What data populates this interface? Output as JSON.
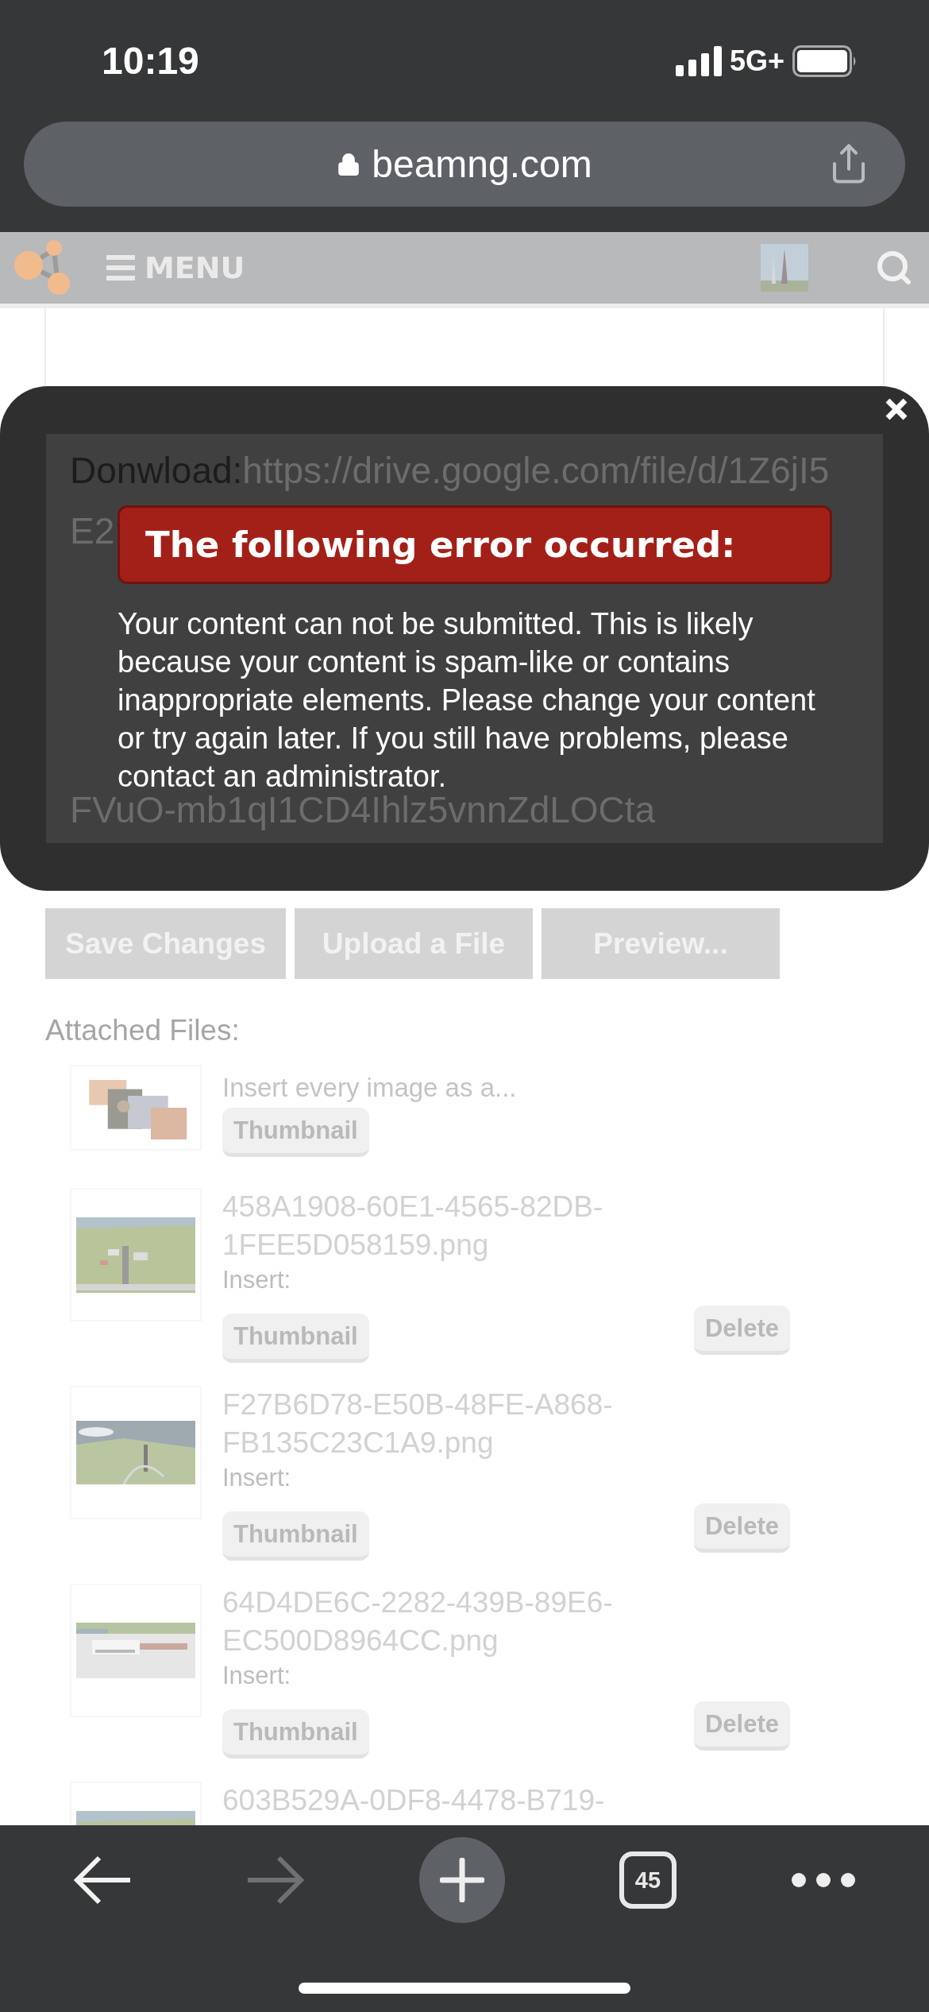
{
  "status_bar": {
    "time": "10:19",
    "network": "5G+"
  },
  "address_bar": {
    "url": "beamng.com"
  },
  "site_nav": {
    "menu_label": "MENU"
  },
  "editor": {
    "paragraphs": [
      {
        "lines": [
          [
            {
              "kind": "text",
              "text": "Donwload:"
            },
            {
              "kind": "link",
              "text": "https://drive.google.com/file/d/1Z6jI5"
            }
          ],
          [
            {
              "kind": "link",
              "text": "E2"
            }
          ]
        ]
      },
      {
        "lines": [
          [
            {
              "kind": "link",
              "text": "FVuO-mb1qI1CD4Ihlz5vnnZdLOCta"
            }
          ]
        ]
      }
    ]
  },
  "error_dialog": {
    "title": "The following error occurred:",
    "message": "Your content can not be submitted. This is likely because your content is spam-like or contains inappropriate elements. Please change your content or try again later. If you still have problems, please contact an administrator."
  },
  "actions": [
    "Save Changes",
    "Upload a File",
    "Preview..."
  ],
  "attachments": {
    "heading": "Attached Files:",
    "insert_all": {
      "label": "Insert every image as a...",
      "button": "Thumbnail"
    },
    "files": [
      {
        "name": "458A1908-60E1-4565-82DB-1FEE5D058159.png",
        "insert_label": "Insert:",
        "insert_button": "Thumbnail",
        "delete_button": "Delete"
      },
      {
        "name": "F27B6D78-E50B-48FE-A868-FB135C23C1A9.png",
        "insert_label": "Insert:",
        "insert_button": "Thumbnail",
        "delete_button": "Delete"
      },
      {
        "name": "64D4DE6C-2282-439B-89E6-EC500D8964CC.png",
        "insert_label": "Insert:",
        "insert_button": "Thumbnail",
        "delete_button": "Delete"
      },
      {
        "name": "603B529A-0DF8-4478-B719-"
      }
    ]
  },
  "toolbar": {
    "tab_count": "45",
    "forward_disabled": true
  }
}
